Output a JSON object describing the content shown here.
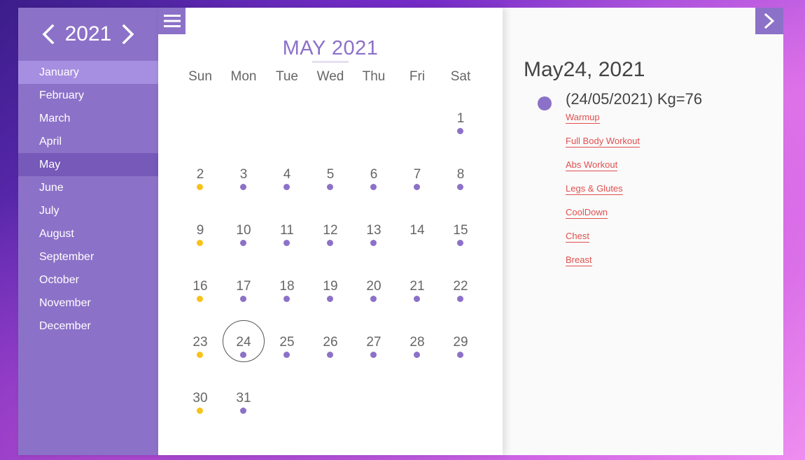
{
  "year": "2021",
  "months": [
    "January",
    "February",
    "March",
    "April",
    "May",
    "June",
    "July",
    "August",
    "September",
    "October",
    "November",
    "December"
  ],
  "calendar": {
    "title": "MAY 2021",
    "weekdays": [
      "Sun",
      "Mon",
      "Tue",
      "Wed",
      "Thu",
      "Fri",
      "Sat"
    ],
    "weeks": [
      [
        null,
        null,
        null,
        null,
        null,
        null,
        {
          "n": "1",
          "dot": "purple"
        }
      ],
      [
        {
          "n": "2",
          "dot": "yellow"
        },
        {
          "n": "3",
          "dot": "purple"
        },
        {
          "n": "4",
          "dot": "purple"
        },
        {
          "n": "5",
          "dot": "purple"
        },
        {
          "n": "6",
          "dot": "purple"
        },
        {
          "n": "7",
          "dot": "purple"
        },
        {
          "n": "8",
          "dot": "purple"
        }
      ],
      [
        {
          "n": "9",
          "dot": "yellow"
        },
        {
          "n": "10",
          "dot": "purple"
        },
        {
          "n": "11",
          "dot": "purple"
        },
        {
          "n": "12",
          "dot": "purple"
        },
        {
          "n": "13",
          "dot": "purple"
        },
        {
          "n": "14",
          "dot": null
        },
        {
          "n": "15",
          "dot": "purple"
        }
      ],
      [
        {
          "n": "16",
          "dot": "yellow"
        },
        {
          "n": "17",
          "dot": "purple"
        },
        {
          "n": "18",
          "dot": "purple"
        },
        {
          "n": "19",
          "dot": "purple"
        },
        {
          "n": "20",
          "dot": "purple"
        },
        {
          "n": "21",
          "dot": "purple"
        },
        {
          "n": "22",
          "dot": "purple"
        }
      ],
      [
        {
          "n": "23",
          "dot": "yellow"
        },
        {
          "n": "24",
          "dot": "purple",
          "selected": true
        },
        {
          "n": "25",
          "dot": "purple"
        },
        {
          "n": "26",
          "dot": "purple"
        },
        {
          "n": "27",
          "dot": "purple"
        },
        {
          "n": "28",
          "dot": "purple"
        },
        {
          "n": "29",
          "dot": "purple"
        }
      ],
      [
        {
          "n": "30",
          "dot": "yellow"
        },
        {
          "n": "31",
          "dot": "purple"
        },
        null,
        null,
        null,
        null,
        null
      ]
    ]
  },
  "detail": {
    "date": "May24, 2021",
    "entry": "(24/05/2021) Kg=76",
    "links": [
      "Warmup",
      "Full Body Workout",
      "Abs Workout",
      "Legs & Glutes",
      "CoolDown",
      "Chest",
      "Breast"
    ]
  },
  "icons": {
    "prev_year": "chevron-left-icon",
    "next_year": "chevron-right-icon",
    "menu": "hamburger-menu-icon",
    "next": "chevron-right-icon"
  },
  "colors": {
    "accent": "#8c71c8",
    "highlight": "#f7c21a",
    "link": "#e0504f"
  }
}
